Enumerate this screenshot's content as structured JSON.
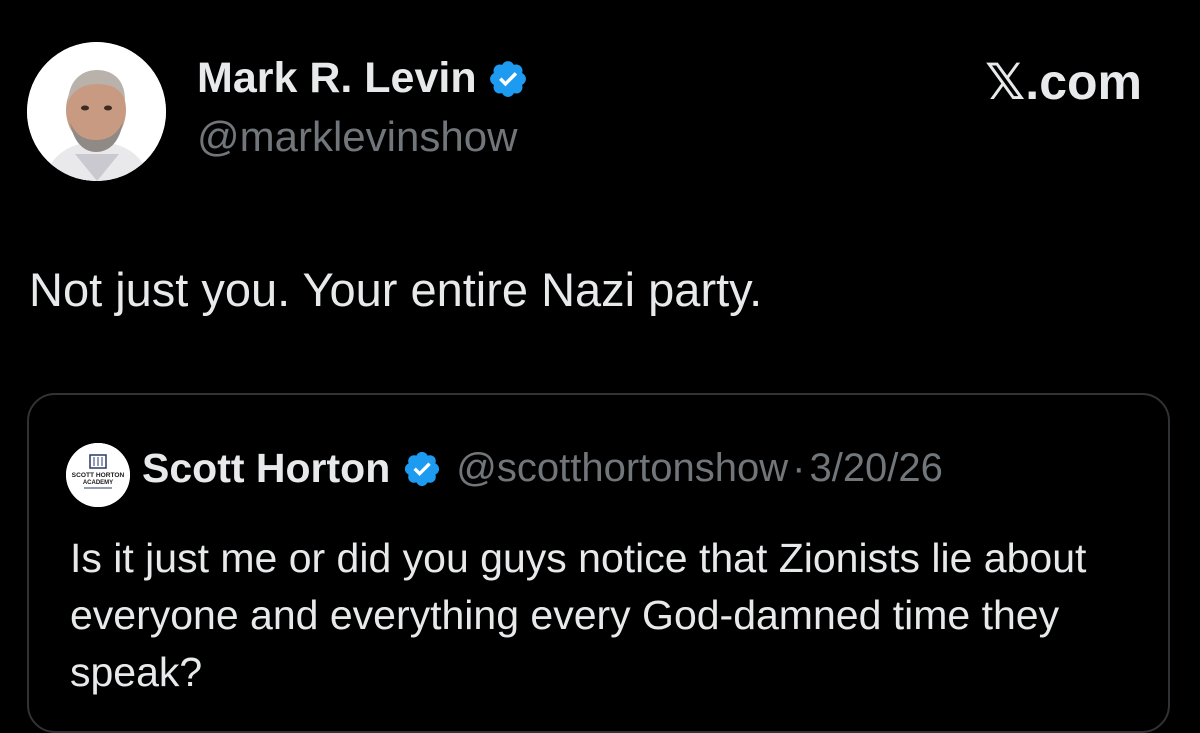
{
  "tweet": {
    "author": {
      "name": "Mark R. Levin",
      "handle": "@marklevinshow",
      "verified": true,
      "avatar_icon": "profile-photo-icon"
    },
    "brand": "𝕏.com",
    "text": "Not just you.  Your entire Nazi party."
  },
  "quote": {
    "author": {
      "name": "Scott Horton",
      "handle": "@scotthortonshow",
      "verified": true,
      "avatar_text_line1": "SCOTT HORTON",
      "avatar_text_line2": "ACADEMY"
    },
    "separator": "·",
    "date": "3/20/26",
    "text": "Is it just me or did you guys notice that Zionists lie about everyone and everything every God-damned time they speak?"
  },
  "colors": {
    "background": "#000000",
    "text_primary": "#e7e9ea",
    "text_secondary": "#71767b",
    "verified_blue": "#1d9bf0",
    "card_border": "#2f3336"
  }
}
